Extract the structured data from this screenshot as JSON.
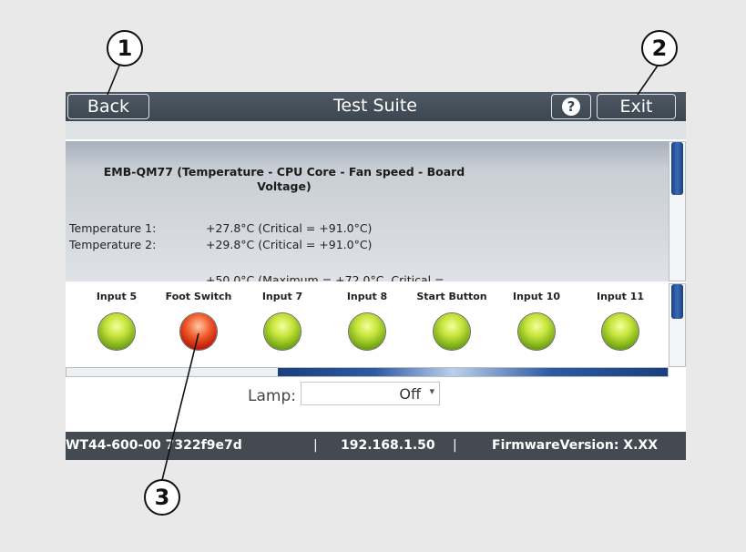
{
  "titlebar": {
    "back_label": "Back",
    "title": "Test Suite",
    "help_label": "?",
    "exit_label": "Exit"
  },
  "info": {
    "heading": "EMB-QM77 (Temperature - CPU Core - Fan speed - Board Voltage)",
    "sensors": [
      {
        "label": "Temperature 1:",
        "value": "+27.8°C (Critical = +91.0°C)"
      },
      {
        "label": "Temperature 2:",
        "value": "+29.8°C (Critical = +91.0°C)"
      }
    ],
    "partial_line": "+50.0°C (Maximum = +72.0°C, Critical ="
  },
  "inputs": [
    {
      "label": "Input 5",
      "state": "green"
    },
    {
      "label": "Foot Switch",
      "state": "red"
    },
    {
      "label": "Input 7",
      "state": "green"
    },
    {
      "label": "Input 8",
      "state": "green"
    },
    {
      "label": "Start Button",
      "state": "green"
    },
    {
      "label": "Input 10",
      "state": "green"
    },
    {
      "label": "Input 11",
      "state": "green"
    }
  ],
  "lamp": {
    "label": "Lamp:",
    "value": "Off",
    "arrow": "▾"
  },
  "status": {
    "serial": "WT44-600-00 7322f9e7d",
    "separator": "|",
    "ip": "192.168.1.50",
    "firmware": "FirmwareVersion: X.XX"
  },
  "callouts": [
    "1",
    "2",
    "3"
  ],
  "colors": {
    "titlebar": "#434a52",
    "led_green": "#9ccc1f",
    "led_red": "#e0341a",
    "scroll_thumb": "#1b3f7c"
  }
}
